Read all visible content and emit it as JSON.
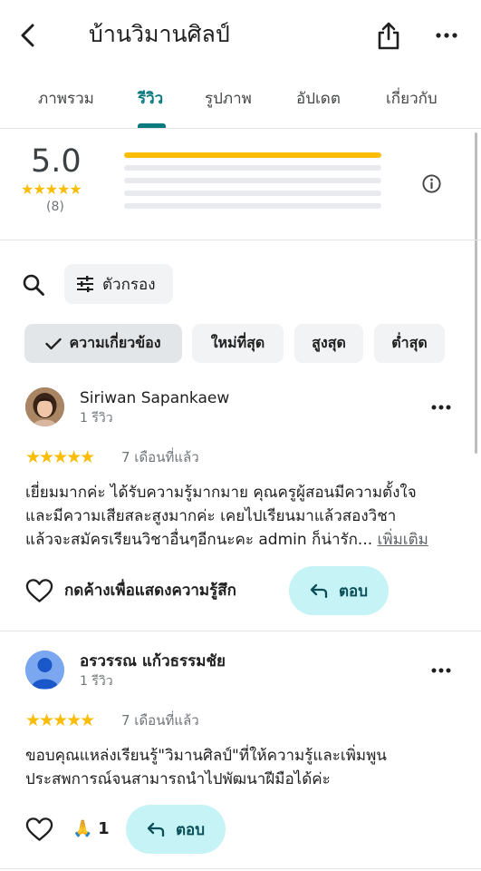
{
  "header": {
    "title": "บ้านวิมานศิลป์"
  },
  "tabs": [
    {
      "label": "ภาพรวม"
    },
    {
      "label": "รีวิว"
    },
    {
      "label": "รูปภาพ"
    },
    {
      "label": "อัปเดต"
    },
    {
      "label": "เกี่ยวกับ"
    }
  ],
  "active_tab": "รีวิว",
  "summary": {
    "average": "5.0",
    "stars": "★★★★★",
    "count": "(8)",
    "distribution": [
      {
        "stars": 5,
        "fraction": 1.0
      },
      {
        "stars": 4,
        "fraction": 0.0
      },
      {
        "stars": 3,
        "fraction": 0.0
      },
      {
        "stars": 2,
        "fraction": 0.0
      },
      {
        "stars": 1,
        "fraction": 0.0
      }
    ]
  },
  "filter": {
    "label": "ตัวกรอง"
  },
  "sort_chips": [
    {
      "label": "ความเกี่ยวข้อง",
      "selected": true
    },
    {
      "label": "ใหม่ที่สุด",
      "selected": false
    },
    {
      "label": "สูงสุด",
      "selected": false
    },
    {
      "label": "ต่ำสุด",
      "selected": false
    }
  ],
  "reviews": [
    {
      "name": "Siriwan Sapankaew",
      "sub": "1 รีวิว",
      "stars": "★★★★★",
      "date": "7 เดือนที่แล้ว",
      "lines": [
        "เยี่ยมมากค่ะ ได้รับความรู้มากมาย  คุณครูผู้สอนมีความตั้งใจ",
        "และมีความเสียสละสูงมากค่ะ  เคยไปเรียนมาแล้วสองวิชา",
        "แล้วจะสมัครเรียนวิชาอื่นๆอีกนะคะ admin ก็น่ารัก..."
      ],
      "more_label": "เพิ่มเติม",
      "like_label": "กดค้างเพื่อแสดงความรู้สึก",
      "reply_label": "ตอบ"
    },
    {
      "name": "อรวรรณ แก้วธรรมชัย",
      "sub": "1 รีวิว",
      "stars": "★★★★★",
      "date": "7 เดือนที่แล้ว",
      "lines": [
        "ขอบคุณแหล่งเรียนรู้\"วิมานศิลป์\"ที่ให้ความรู้และเพิ่มพูน",
        "ประสพการณ์จนสามารถนำไปพัฒนาฝีมือได้ค่ะ"
      ],
      "reaction_emoji": "🙏",
      "reaction_count": "1",
      "reply_label": "ตอบ"
    }
  ],
  "colors": {
    "accent": "#0b7a7d",
    "star": "#fbbc04",
    "reply_bg": "#c5f3f6",
    "chip_bg": "#f1f3f4"
  }
}
